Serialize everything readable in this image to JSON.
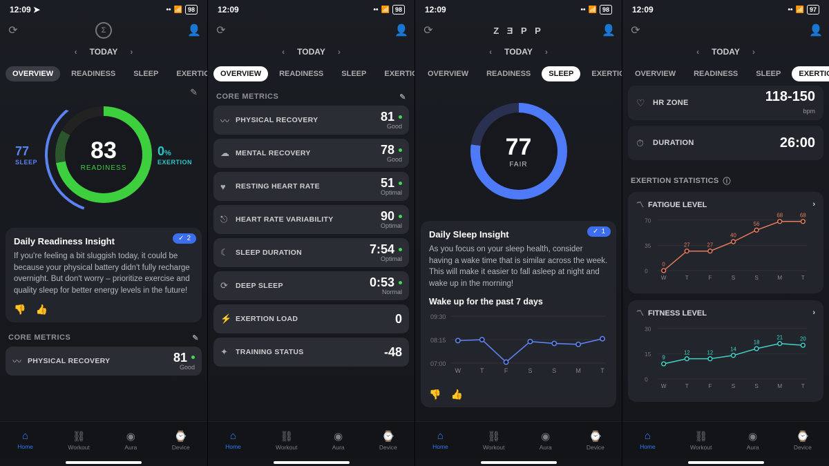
{
  "status": {
    "time": "12:09",
    "loc": "➤",
    "sig": "▪▪▪",
    "wifi": "✓",
    "batt1": "98",
    "batt2": "97"
  },
  "logo": "Z Ǝ P P",
  "today": "TODAY",
  "tabs": {
    "overview": "OVERVIEW",
    "readiness": "READINESS",
    "sleep": "SLEEP",
    "exertion": "EXERTION"
  },
  "tabbar": {
    "home": "Home",
    "workout": "Workout",
    "aura": "Aura",
    "device": "Device"
  },
  "p1": {
    "ring": {
      "val": "83",
      "lbl": "READINESS"
    },
    "sleep": {
      "val": "77",
      "lbl": "SLEEP"
    },
    "exertion": {
      "val": "0",
      "pct": "%",
      "lbl": "EXERTION"
    },
    "insight": {
      "title": "Daily Readiness Insight",
      "badge": "2",
      "body": "If you're feeling a bit sluggish today, it could be because your physical battery didn't fully recharge overnight. But don't worry – prioritize exercise and quality sleep for better energy levels in the future!"
    },
    "sect": "CORE METRICS",
    "m1": {
      "name": "PHYSICAL RECOVERY",
      "val": "81",
      "sub": "Good"
    }
  },
  "p2": {
    "sect": "CORE METRICS",
    "m": [
      {
        "ic": "〰",
        "name": "PHYSICAL RECOVERY",
        "val": "81",
        "sub": "Good",
        "dot": true
      },
      {
        "ic": "☁",
        "name": "MENTAL RECOVERY",
        "val": "78",
        "sub": "Good",
        "dot": true
      },
      {
        "ic": "♥",
        "name": "RESTING HEART RATE",
        "val": "51",
        "sub": "Optimal",
        "dot": true
      },
      {
        "ic": "⎋",
        "name": "HEART RATE VARIABILITY",
        "val": "90",
        "sub": "Optimal",
        "dot": true
      },
      {
        "ic": "☾",
        "name": "SLEEP DURATION",
        "val": "7:54",
        "sub": "Optimal",
        "dot": true
      },
      {
        "ic": "⟳",
        "name": "DEEP SLEEP",
        "val": "0:53",
        "sub": "Normal",
        "dot": true
      },
      {
        "ic": "⚡",
        "name": "EXERTION LOAD",
        "val": "0",
        "sub": "",
        "dot": false
      },
      {
        "ic": "✦",
        "name": "TRAINING STATUS",
        "val": "-48",
        "sub": "",
        "dot": false
      }
    ]
  },
  "p3": {
    "ring": {
      "val": "77",
      "lbl": "FAIR"
    },
    "insight": {
      "title": "Daily Sleep Insight",
      "badge": "1",
      "body": "As you focus on your sleep health, consider having a wake time that is similar across the week. This will make it easier to fall asleep at night and wake up in the morning!"
    },
    "waketitle": "Wake up for the past 7 days"
  },
  "p4": {
    "hr": {
      "name": "HR ZONE",
      "val": "118-150",
      "sub": "bpm"
    },
    "dur": {
      "name": "DURATION",
      "val": "26:00"
    },
    "sect": "EXERTION STATISTICS",
    "fat": "FATIGUE LEVEL",
    "fit": "FITNESS LEVEL"
  },
  "chart_data": [
    {
      "type": "line",
      "title": "Wake up for the past 7 days",
      "categories": [
        "W",
        "T",
        "F",
        "S",
        "S",
        "M",
        "T"
      ],
      "y_ticks": [
        "09:30",
        "08:15",
        "07:00"
      ],
      "values": [
        8.2,
        8.25,
        7.05,
        8.15,
        8.05,
        8.0,
        8.3
      ]
    },
    {
      "type": "line",
      "title": "FATIGUE LEVEL",
      "categories": [
        "W",
        "T",
        "F",
        "S",
        "S",
        "M",
        "T"
      ],
      "y_ticks": [
        70,
        35,
        0
      ],
      "values": [
        0,
        27,
        27,
        40,
        56,
        68,
        68
      ],
      "color": "#e87b5c"
    },
    {
      "type": "line",
      "title": "FITNESS LEVEL",
      "categories": [
        "W",
        "T",
        "F",
        "S",
        "S",
        "M",
        "T"
      ],
      "y_ticks": [
        30,
        15,
        0
      ],
      "values": [
        9,
        12,
        12,
        14,
        18,
        21,
        20
      ],
      "color": "#3fd4c9"
    }
  ]
}
